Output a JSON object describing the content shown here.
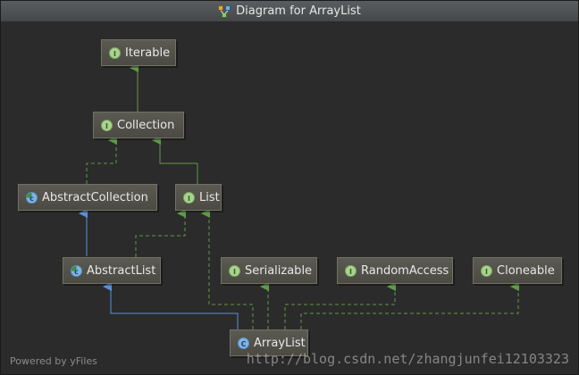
{
  "window": {
    "title": "Diagram for ArrayList",
    "title_icon": "diagram-icon"
  },
  "nodes": {
    "iterable": {
      "label": "Iterable",
      "badge": "I",
      "kind": "interface"
    },
    "collection": {
      "label": "Collection",
      "badge": "I",
      "kind": "interface"
    },
    "abstract_collection": {
      "label": "AbstractCollection",
      "badge": "c",
      "kind": "abstract-class"
    },
    "list": {
      "label": "List",
      "badge": "I",
      "kind": "interface"
    },
    "abstract_list": {
      "label": "AbstractList",
      "badge": "c",
      "kind": "abstract-class"
    },
    "serializable": {
      "label": "Serializable",
      "badge": "I",
      "kind": "interface"
    },
    "random_access": {
      "label": "RandomAccess",
      "badge": "I",
      "kind": "interface"
    },
    "cloneable": {
      "label": "Cloneable",
      "badge": "I",
      "kind": "interface"
    },
    "array_list": {
      "label": "ArrayList",
      "badge": "C",
      "kind": "class"
    }
  },
  "colors": {
    "implements_edge": "#5f9a48",
    "extends_edge": "#5a8fd8",
    "background": "#2b2b2b"
  },
  "footer": {
    "powered_by": "Powered by yFiles"
  },
  "watermark": {
    "text": "http://blog.csdn.net/zhangjunfei12103323"
  }
}
